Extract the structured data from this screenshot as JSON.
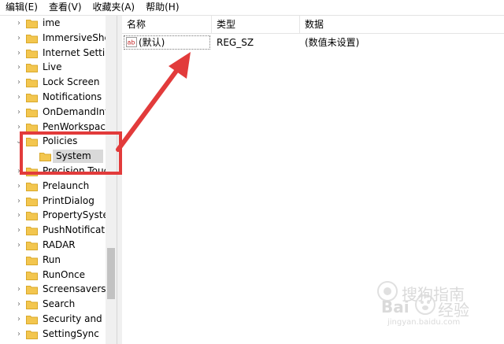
{
  "menubar": {
    "items": [
      "编辑(E)",
      "查看(V)",
      "收藏夹(A)",
      "帮助(H)"
    ]
  },
  "tree": {
    "items": [
      {
        "label": "ime",
        "expandable": true
      },
      {
        "label": "ImmersiveShel",
        "expandable": true
      },
      {
        "label": "Internet Setting",
        "expandable": true
      },
      {
        "label": "Live",
        "expandable": true
      },
      {
        "label": "Lock Screen",
        "expandable": true
      },
      {
        "label": "Notifications",
        "expandable": true
      },
      {
        "label": "OnDemandInte",
        "expandable": true
      },
      {
        "label": "PenWorkspace",
        "expandable": true
      },
      {
        "label": "Policies",
        "expandable": true,
        "expanded": true
      },
      {
        "label": "System",
        "expandable": false,
        "selected": true,
        "child": true
      },
      {
        "label": "Precision Touch",
        "expandable": true
      },
      {
        "label": "Prelaunch",
        "expandable": true
      },
      {
        "label": "PrintDialog",
        "expandable": true
      },
      {
        "label": "PropertySyster",
        "expandable": true
      },
      {
        "label": "PushNotificati",
        "expandable": true
      },
      {
        "label": "RADAR",
        "expandable": true
      },
      {
        "label": "Run",
        "expandable": false
      },
      {
        "label": "RunOnce",
        "expandable": false
      },
      {
        "label": "Screensavers",
        "expandable": true
      },
      {
        "label": "Search",
        "expandable": true
      },
      {
        "label": "Security and M",
        "expandable": true
      },
      {
        "label": "SettingSync",
        "expandable": true
      }
    ]
  },
  "list": {
    "columns": [
      "名称",
      "类型",
      "数据"
    ],
    "rows": [
      {
        "name": "(默认)",
        "type": "REG_SZ",
        "data": "(数值未设置)",
        "icon": "string-value-icon"
      }
    ]
  },
  "watermark": {
    "brand": "Bai",
    "brand_cn": "百度",
    "product": "经验",
    "url": "jingyan.baidu.com",
    "cn_top": "搜狗指南"
  },
  "colors": {
    "annotation": "#e23b3b",
    "folder": "#f3c64f",
    "selection": "#d9d9d9"
  }
}
